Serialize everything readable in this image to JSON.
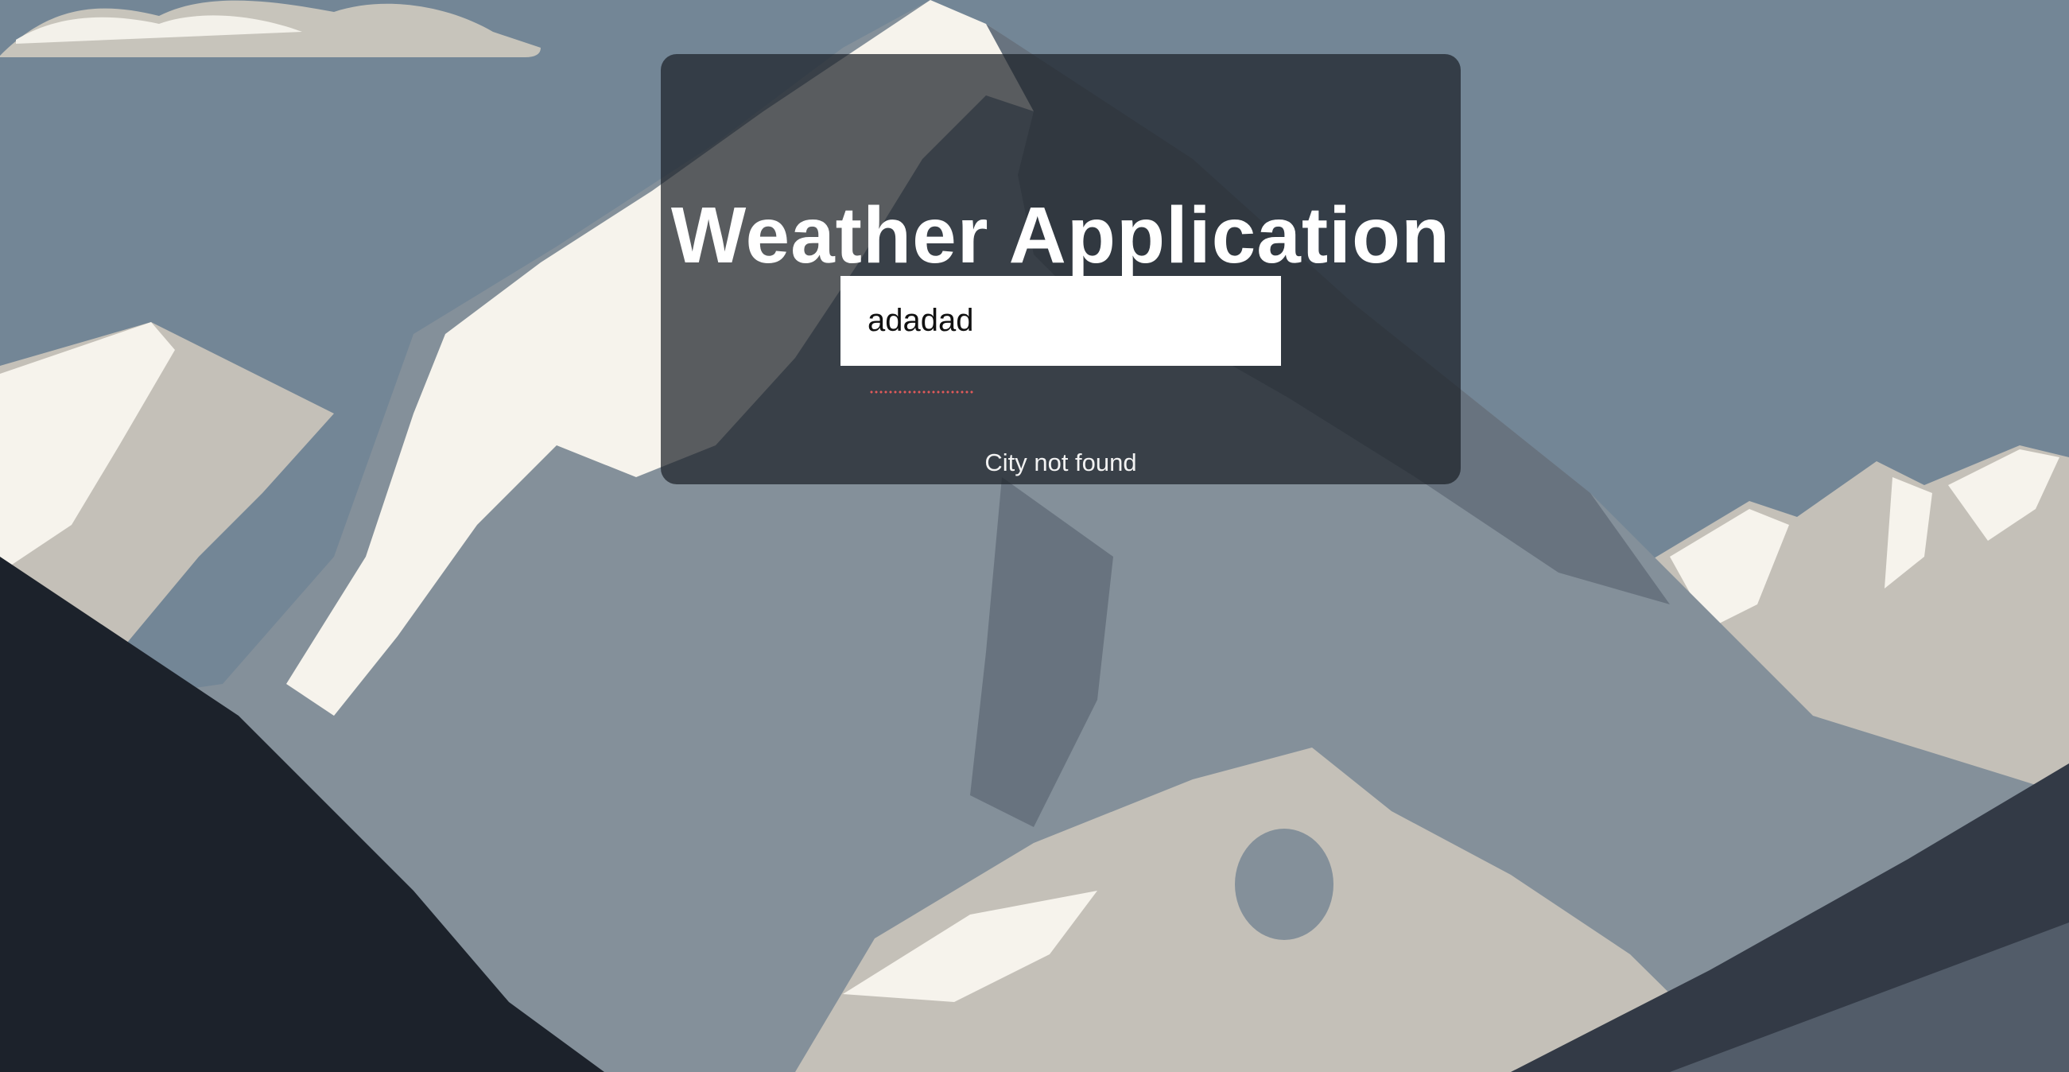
{
  "app": {
    "title": "Weather Application"
  },
  "search": {
    "value": "adadad",
    "placeholder": ""
  },
  "status": {
    "message": "City not found"
  },
  "colors": {
    "sky": "#738696",
    "card_overlay": "rgba(28,33,40,0.72)",
    "snow": "#f6f3ec",
    "rock_light": "#c4c0b8",
    "rock_mid": "#84909a",
    "rock_dark": "#68737f",
    "foreground_dark": "#1c222b"
  },
  "background": {
    "icon": "mountain-landscape-illustration"
  }
}
